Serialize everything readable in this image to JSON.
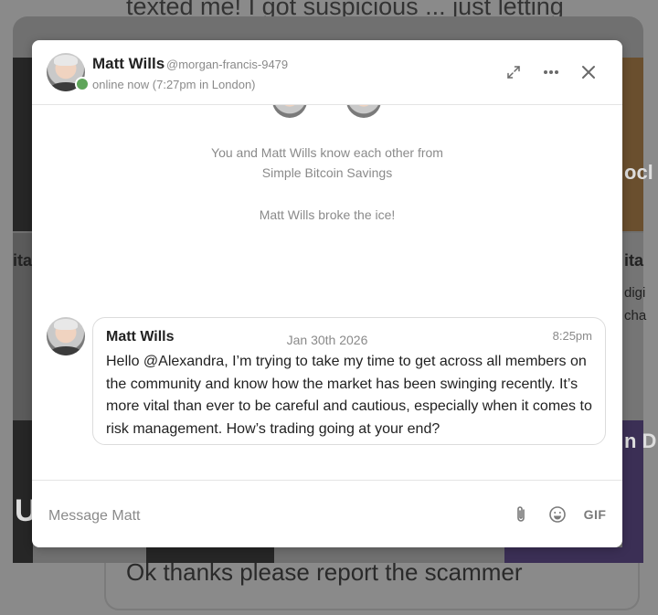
{
  "background": {
    "top_text": "texted me! I got suspicious ... just letting",
    "bottom_text": "Ok thanks please report the scammer",
    "left_fragment": "ita",
    "right_fragment": "ita",
    "right_frag_2": "digi",
    "right_frag_3": "cha",
    "right_frag_4": "ocl",
    "right_frag_5": "n D",
    "left_big": "U"
  },
  "header": {
    "name": "Matt Wills",
    "handle": "@morgan-francis-9479",
    "status": "online now (7:27pm in London)",
    "expand_icon": "expand-icon",
    "more_icon": "more-icon",
    "close_icon": "close-icon",
    "status_color": "#5fa55a"
  },
  "conversation": {
    "known_from_line1": "You and Matt Wills know each other from",
    "known_from_line2": "Simple Bitcoin Savings",
    "ice_breaker": "Matt Wills broke the ice!",
    "date": "Jan 30th 2026",
    "messages": [
      {
        "author": "Matt Wills",
        "time": "8:25pm",
        "text": "Hello @Alexandra, I’m trying to take my time to get across all members on the community and know how the market has been swinging recently. It’s more vital than ever to be careful and cautious, especially when it comes to risk management. How’s trading going at your end?"
      }
    ]
  },
  "composer": {
    "placeholder": "Message Matt",
    "value": "",
    "attach_icon": "paperclip-icon",
    "emoji_icon": "emoji-icon",
    "gif_label": "GIF"
  }
}
